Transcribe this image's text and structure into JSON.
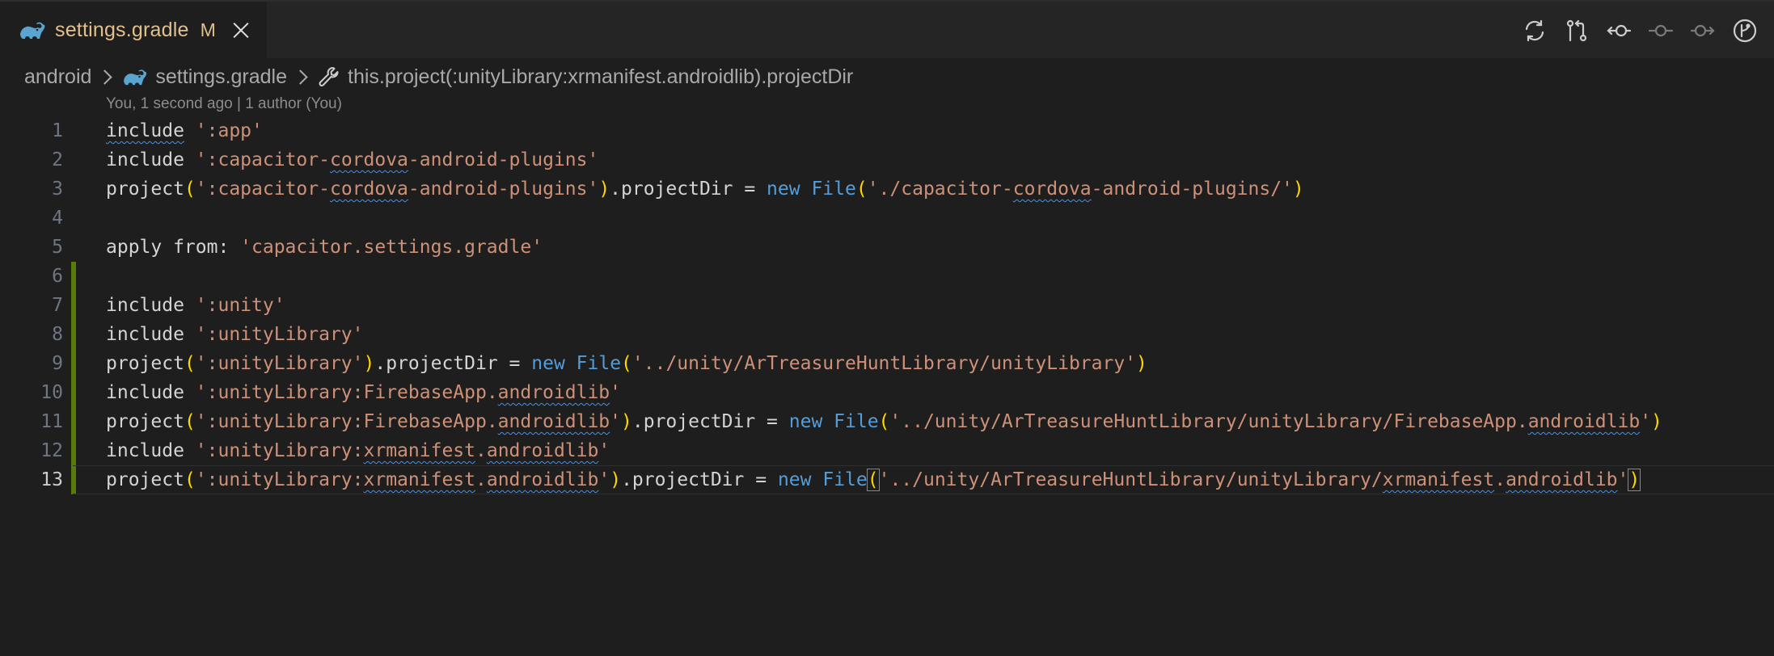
{
  "tab": {
    "filename": "settings.gradle",
    "status": "M"
  },
  "breadcrumb": {
    "folder": "android",
    "file": "settings.gradle",
    "symbol": "this.project(:unityLibrary:xrmanifest.androidlib).projectDir"
  },
  "blame": "You, 1 second ago | 1 author (You)",
  "colors": {
    "string": "#ce9178",
    "keyword": "#569cd6",
    "paren": "#ffd700",
    "gutter_modified": "#587c0c",
    "tab_modified": "#e2c08d"
  },
  "icons": [
    "gradle-icon",
    "close-icon",
    "sync-icon",
    "compare-changes-icon",
    "go-back-icon",
    "timeline-icon",
    "go-forward-icon",
    "git-graph-icon",
    "chevron-right-icon",
    "wrench-icon"
  ],
  "lines": [
    {
      "n": "1",
      "tokens": [
        [
          "kw",
          "include",
          1
        ],
        [
          "txt",
          " "
        ],
        [
          "str",
          "':app'"
        ]
      ]
    },
    {
      "n": "2",
      "tokens": [
        [
          "kw",
          "include"
        ],
        [
          "txt",
          " "
        ],
        [
          "str",
          "':capacitor-"
        ],
        [
          "str",
          "cordova",
          1
        ],
        [
          "str",
          "-android-plugins'"
        ]
      ]
    },
    {
      "n": "3",
      "tokens": [
        [
          "kw",
          "project"
        ],
        [
          "paren",
          "("
        ],
        [
          "str",
          "':capacitor-"
        ],
        [
          "str",
          "cordova",
          1
        ],
        [
          "str",
          "-android-plugins'"
        ],
        [
          "paren",
          ")"
        ],
        [
          "txt",
          ".projectDir = "
        ],
        [
          "new",
          "new"
        ],
        [
          "txt",
          " "
        ],
        [
          "ctor",
          "File"
        ],
        [
          "paren",
          "("
        ],
        [
          "str",
          "'./capacitor-"
        ],
        [
          "str",
          "cordova",
          1
        ],
        [
          "str",
          "-android-plugins/'"
        ],
        [
          "paren",
          ")"
        ]
      ]
    },
    {
      "n": "4",
      "tokens": []
    },
    {
      "n": "5",
      "tokens": [
        [
          "kw",
          "apply from: "
        ],
        [
          "str",
          "'capacitor.settings.gradle'"
        ]
      ]
    },
    {
      "n": "6",
      "tokens": [],
      "modified": true
    },
    {
      "n": "7",
      "tokens": [
        [
          "kw",
          "include"
        ],
        [
          "txt",
          " "
        ],
        [
          "str",
          "':unity'"
        ]
      ],
      "modified": true
    },
    {
      "n": "8",
      "tokens": [
        [
          "kw",
          "include"
        ],
        [
          "txt",
          " "
        ],
        [
          "str",
          "':unityLibrary'"
        ]
      ],
      "modified": true
    },
    {
      "n": "9",
      "tokens": [
        [
          "kw",
          "project"
        ],
        [
          "paren",
          "("
        ],
        [
          "str",
          "':unityLibrary'"
        ],
        [
          "paren",
          ")"
        ],
        [
          "txt",
          ".projectDir = "
        ],
        [
          "new",
          "new"
        ],
        [
          "txt",
          " "
        ],
        [
          "ctor",
          "File"
        ],
        [
          "paren",
          "("
        ],
        [
          "str",
          "'../unity/ArTreasureHuntLibrary/unityLibrary'"
        ],
        [
          "paren",
          ")"
        ]
      ],
      "modified": true
    },
    {
      "n": "10",
      "tokens": [
        [
          "kw",
          "include"
        ],
        [
          "txt",
          " "
        ],
        [
          "str",
          "':unityLibrary:FirebaseApp."
        ],
        [
          "str",
          "androidlib",
          1
        ],
        [
          "str",
          "'"
        ]
      ],
      "modified": true
    },
    {
      "n": "11",
      "tokens": [
        [
          "kw",
          "project"
        ],
        [
          "paren",
          "("
        ],
        [
          "str",
          "':unityLibrary:FirebaseApp."
        ],
        [
          "str",
          "androidlib",
          1
        ],
        [
          "str",
          "'"
        ],
        [
          "paren",
          ")"
        ],
        [
          "txt",
          ".projectDir = "
        ],
        [
          "new",
          "new"
        ],
        [
          "txt",
          " "
        ],
        [
          "ctor",
          "File"
        ],
        [
          "paren",
          "("
        ],
        [
          "str",
          "'../unity/ArTreasureHuntLibrary/unityLibrary/FirebaseApp."
        ],
        [
          "str",
          "androidlib",
          1
        ],
        [
          "str",
          "'"
        ],
        [
          "paren",
          ")"
        ]
      ],
      "modified": true
    },
    {
      "n": "12",
      "tokens": [
        [
          "kw",
          "include"
        ],
        [
          "txt",
          " "
        ],
        [
          "str",
          "':unityLibrary:"
        ],
        [
          "str",
          "xrmanifest",
          1
        ],
        [
          "str",
          "."
        ],
        [
          "str",
          "androidlib",
          1
        ],
        [
          "str",
          "'"
        ]
      ],
      "modified": true
    },
    {
      "n": "13",
      "tokens": [
        [
          "kw",
          "project"
        ],
        [
          "paren",
          "("
        ],
        [
          "str",
          "':unityLibrary:"
        ],
        [
          "str",
          "xrmanifest",
          1
        ],
        [
          "str",
          "."
        ],
        [
          "str",
          "androidlib",
          1
        ],
        [
          "str",
          "'"
        ],
        [
          "paren",
          ")"
        ],
        [
          "txt",
          ".projectDir = "
        ],
        [
          "new",
          "new"
        ],
        [
          "txt",
          " "
        ],
        [
          "ctor",
          "File"
        ],
        [
          "paren",
          "(",
          0,
          1
        ],
        [
          "str",
          "'../unity/ArTreasureHuntLibrary/unityLibrary/"
        ],
        [
          "str",
          "xrmanifest",
          1
        ],
        [
          "str",
          "."
        ],
        [
          "str",
          "androidlib",
          1
        ],
        [
          "str",
          "'"
        ],
        [
          "paren",
          ")",
          0,
          1
        ]
      ],
      "modified": true,
      "current": true
    }
  ]
}
